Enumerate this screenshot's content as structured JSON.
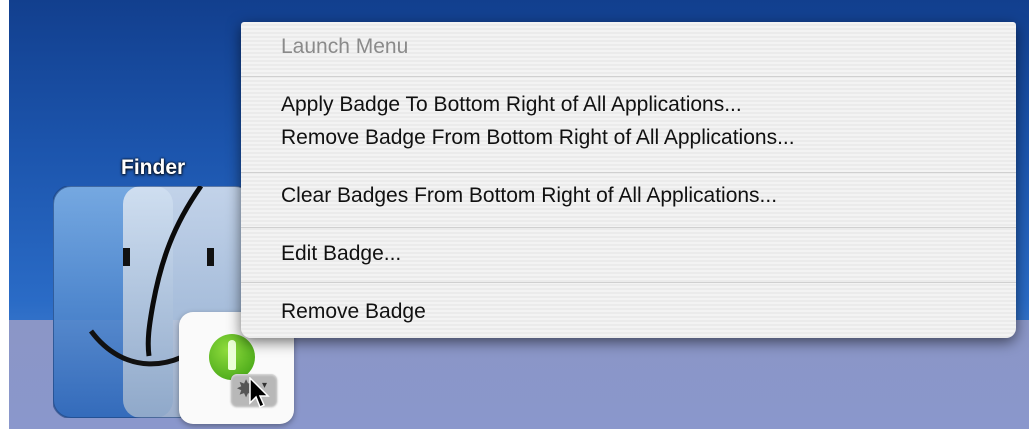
{
  "dock": {
    "finder_label": "Finder"
  },
  "context_menu": {
    "header": "Launch Menu",
    "items": [
      "Apply Badge To Bottom Right of All Applications...",
      "Remove Badge From Bottom Right of All Applications...",
      "Clear Badges From Bottom Right of All Applications...",
      "Edit Badge...",
      "Remove Badge"
    ]
  },
  "icons": [
    "finder-icon",
    "plugin-icon",
    "gear-icon",
    "chevron-down-icon",
    "mouse-pointer-icon"
  ],
  "colors": {
    "desktop": "#1c55ad",
    "menu_bg": "#f0f0f0",
    "green_badge": "#5ab822"
  }
}
